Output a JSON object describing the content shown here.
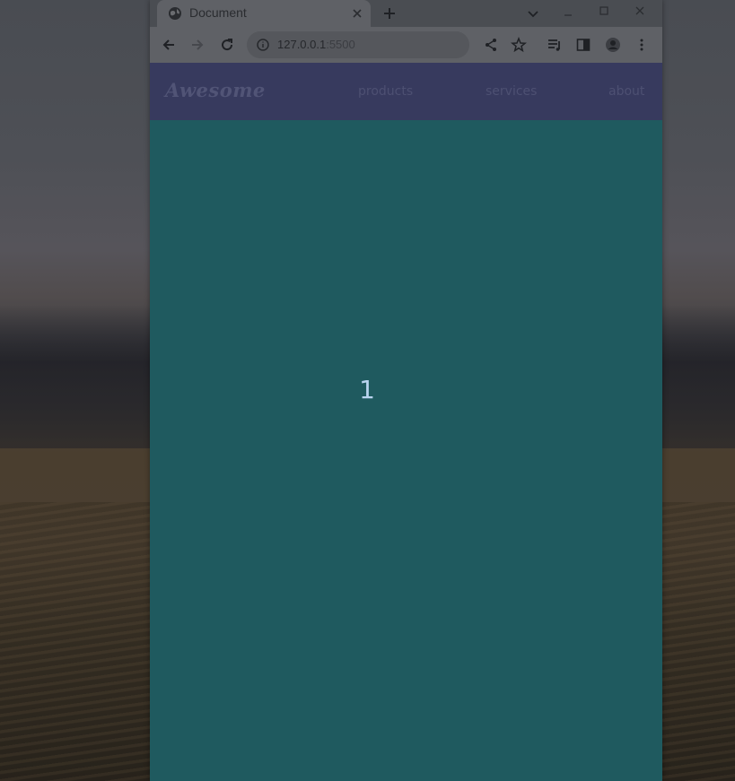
{
  "browser": {
    "tab": {
      "title": "Document",
      "favicon": "globe-icon"
    },
    "address_bar": {
      "host": "127.0.0.1",
      "port": ":5500"
    }
  },
  "page": {
    "navbar": {
      "brand": "Awesome",
      "links": [
        {
          "label": "products"
        },
        {
          "label": "services"
        },
        {
          "label": "about"
        }
      ]
    },
    "slide": {
      "number": "1"
    }
  },
  "colors": {
    "navbar_bg": "#373a5e",
    "page_bg": "#1f5a5f",
    "slide_number": "#b9d4ef"
  }
}
